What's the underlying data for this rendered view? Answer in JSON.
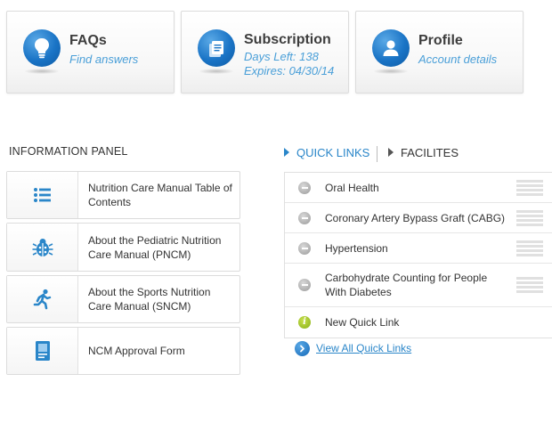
{
  "tiles": [
    {
      "title": "FAQs",
      "lines": [
        "Find answers"
      ],
      "icon": "lightbulb-icon"
    },
    {
      "title": "Subscription",
      "lines": [
        "Days Left: 138",
        "Expires: 04/30/14"
      ],
      "icon": "documents-icon"
    },
    {
      "title": "Profile",
      "lines": [
        "Account details"
      ],
      "icon": "user-icon"
    }
  ],
  "info_panel": {
    "heading": "INFORMATION PANEL",
    "items": [
      {
        "label": "Nutrition Care Manual Table of Contents",
        "icon": "list-icon"
      },
      {
        "label": "About the Pediatric Nutrition Care Manual (PNCM)",
        "icon": "bug-icon"
      },
      {
        "label": "About the Sports Nutrition Care Manual (SNCM)",
        "icon": "runner-icon"
      },
      {
        "label": "NCM Approval Form",
        "icon": "form-icon"
      }
    ]
  },
  "quick_links": {
    "tabs": [
      "QUICK LINKS",
      "FACILITES"
    ],
    "active_tab": "QUICK LINKS",
    "items": [
      {
        "label": "Oral Health",
        "bullet": "minus"
      },
      {
        "label": "Coronary Artery Bypass Graft (CABG)",
        "bullet": "minus"
      },
      {
        "label": "Hypertension",
        "bullet": "minus"
      },
      {
        "label": "Carbohydrate Counting for People With Diabetes",
        "bullet": "minus"
      },
      {
        "label": "New Quick Link",
        "bullet": "info"
      }
    ],
    "view_all_label": "View All Quick Links"
  },
  "colors": {
    "accent_blue": "#2a86c9",
    "subtitle_blue": "#4a9fd8",
    "icon_blue": "#1a74c6",
    "new_link_green": "#88b01a"
  }
}
